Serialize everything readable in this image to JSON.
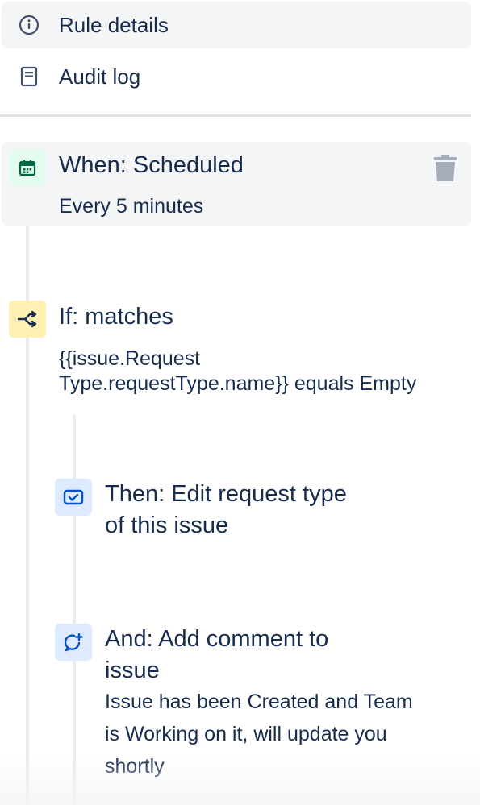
{
  "nav": {
    "rule_details_label": "Rule details",
    "audit_log_label": "Audit log"
  },
  "trigger": {
    "title": "When: Scheduled",
    "subtitle": "Every 5 minutes",
    "icon": "calendar-icon",
    "icon_bg": "#e3fcef",
    "icon_color": "#006644"
  },
  "condition": {
    "title": "If: matches",
    "line1": "{{issue.Request",
    "line2": "Type.requestType.name}} equals Empty",
    "icon": "branch-icon",
    "icon_bg": "#fff0b3",
    "icon_color": "#172b4d"
  },
  "actions": [
    {
      "title_line1": "Then: Edit request type",
      "title_line2": "of this issue",
      "icon": "edit-request-icon",
      "icon_bg": "#deebff",
      "icon_color": "#0052cc"
    },
    {
      "title_line1": "And: Add comment to",
      "title_line2": "issue",
      "desc_line1": "Issue has been Created and Team",
      "desc_line2": "is Working on it, will update you",
      "desc_line3": "shortly",
      "icon": "add-comment-icon",
      "icon_bg": "#deebff",
      "icon_color": "#0052cc"
    }
  ]
}
